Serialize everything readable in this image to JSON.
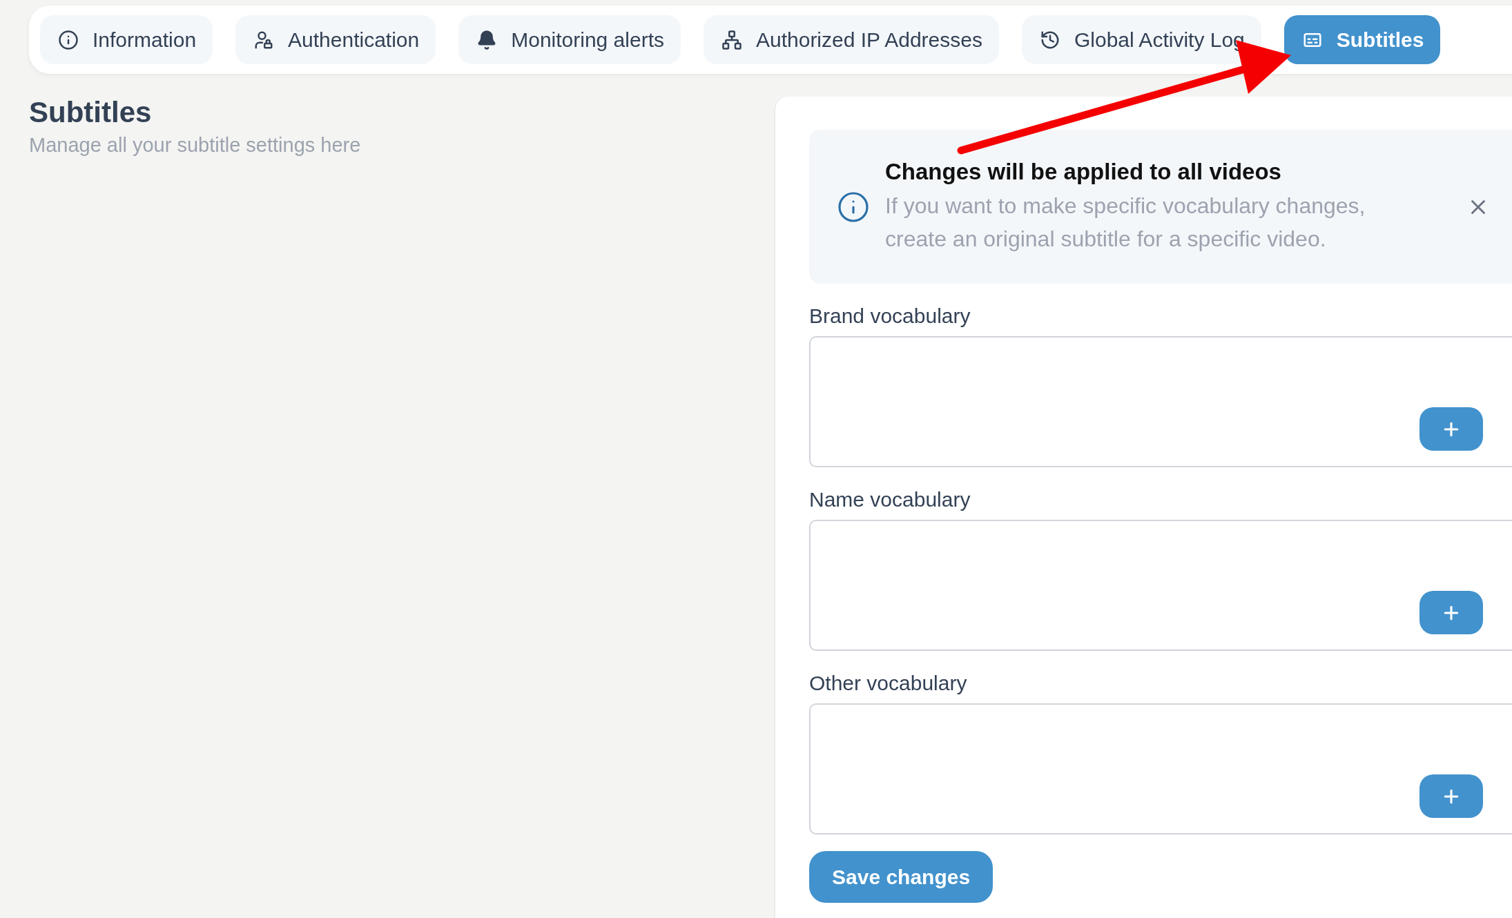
{
  "tabs": [
    {
      "label": "Information",
      "selected": false
    },
    {
      "label": "Authentication",
      "selected": false
    },
    {
      "label": "Monitoring alerts",
      "selected": false
    },
    {
      "label": "Authorized IP Addresses",
      "selected": false
    },
    {
      "label": "Global Activity Log",
      "selected": false
    },
    {
      "label": "Subtitles",
      "selected": true
    }
  ],
  "page": {
    "title": "Subtitles",
    "subtitle": "Manage all your subtitle settings here"
  },
  "notice": {
    "title": "Changes will be applied to all videos",
    "body": "If you want to make specific vocabulary changes, create an original subtitle for a specific video."
  },
  "fields": [
    {
      "label": "Brand vocabulary"
    },
    {
      "label": "Name vocabulary"
    },
    {
      "label": "Other vocabulary"
    }
  ],
  "save_button": "Save changes",
  "annotation": {
    "kind": "arrow"
  }
}
